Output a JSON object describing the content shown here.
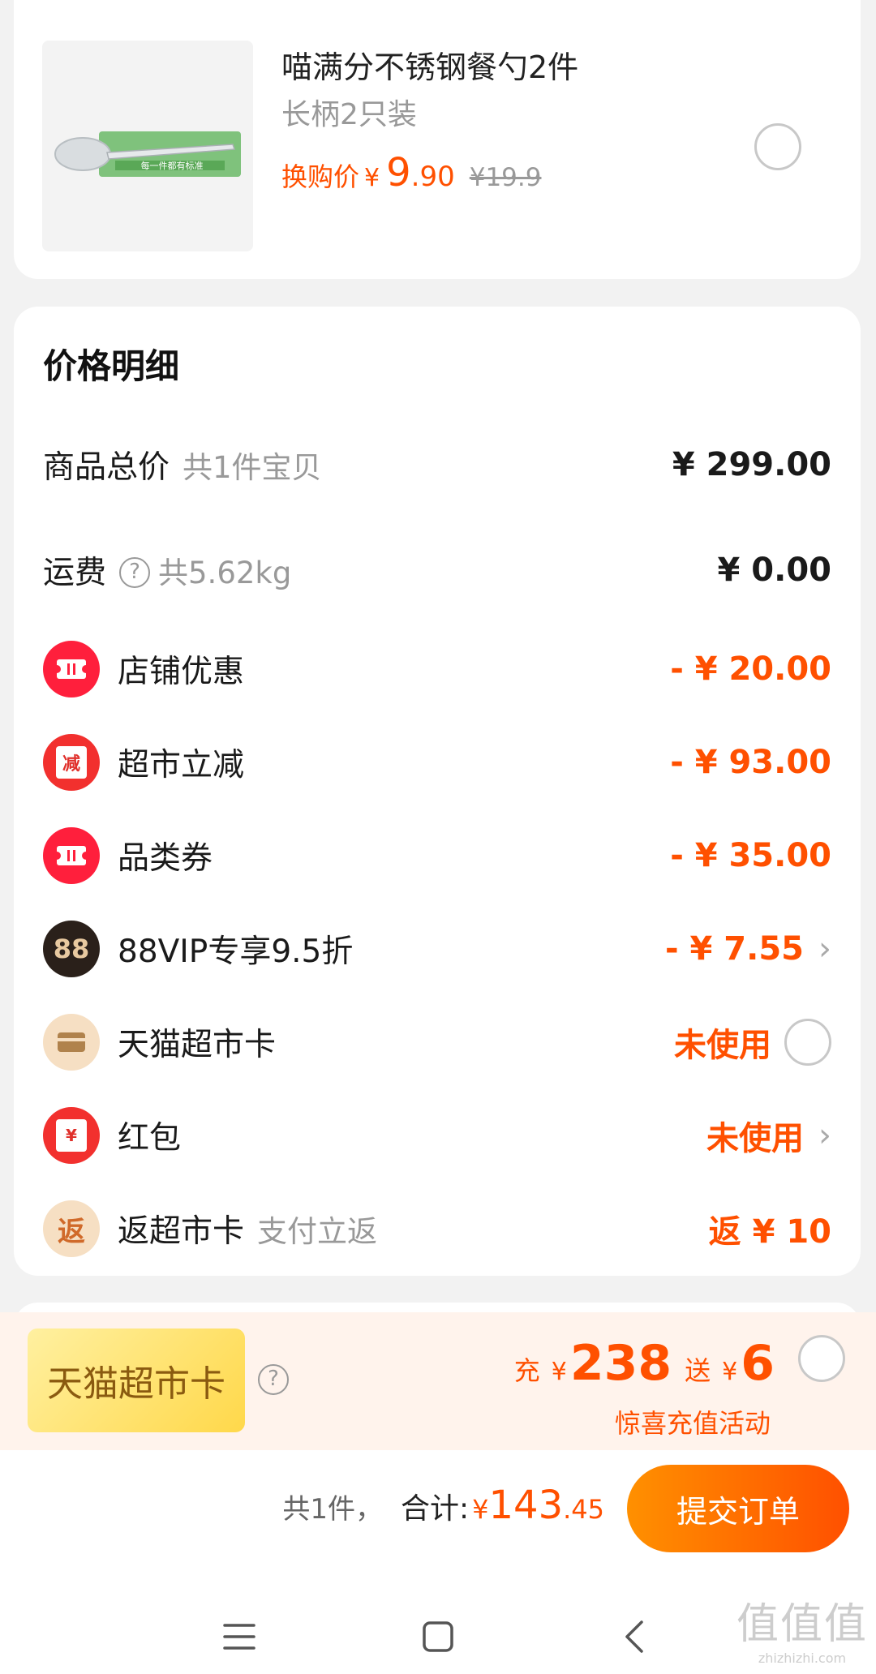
{
  "product": {
    "thumb_caption": "每一件都有标准",
    "title": "喵满分不锈钢餐勺2件",
    "subtitle": "长柄2只装",
    "price_label": "换购价",
    "price_yen": "¥",
    "price_int": "9",
    "price_dec": ".90",
    "orig_price": "¥19.9"
  },
  "price_detail": {
    "title": "价格明细",
    "rows": [
      {
        "label": "商品总价",
        "hint": "共1件宝贝",
        "value": "¥ 299.00"
      },
      {
        "label": "运费",
        "hint": "共5.62kg",
        "value": "¥ 0.00"
      },
      {
        "label": "店铺优惠",
        "value": "- ¥ 20.00",
        "icon": "ticket-icon"
      },
      {
        "label": "超市立减",
        "icon_text": "减",
        "value": "- ¥ 93.00",
        "icon": "discount-icon"
      },
      {
        "label": "品类券",
        "value": "- ¥ 35.00",
        "icon": "coupon-icon"
      },
      {
        "label": "88VIP专享9.5折",
        "icon_text": "88",
        "value": "- ¥ 7.55",
        "icon": "vip-icon"
      },
      {
        "label": "天猫超市卡",
        "value": "未使用",
        "icon": "card-icon"
      },
      {
        "label": "红包",
        "icon_text": "¥",
        "value": "未使用",
        "icon": "red-envelope-icon"
      },
      {
        "label": "返超市卡",
        "hint": "支付立返",
        "icon_text": "返",
        "value": "返 ¥ 10",
        "icon": "cashback-icon"
      }
    ]
  },
  "tmall_card": {
    "badge": "天猫超市卡",
    "recharge_prefix": "充",
    "recharge_yen": "¥",
    "recharge_amount": "238",
    "gift_prefix": "送",
    "gift_yen": "¥",
    "gift_amount": "6",
    "activity": "惊喜充值活动"
  },
  "footer": {
    "count": "共1件，",
    "total_label": "合计:",
    "total_yen": "¥",
    "total_int": "143",
    "total_dec": ".45",
    "submit": "提交订单"
  },
  "watermark": {
    "big": "值值值",
    "small": "zhizhizhi.com"
  },
  "colors": {
    "accent": "#ff5000",
    "coupon_red": "#ff1f3c"
  }
}
